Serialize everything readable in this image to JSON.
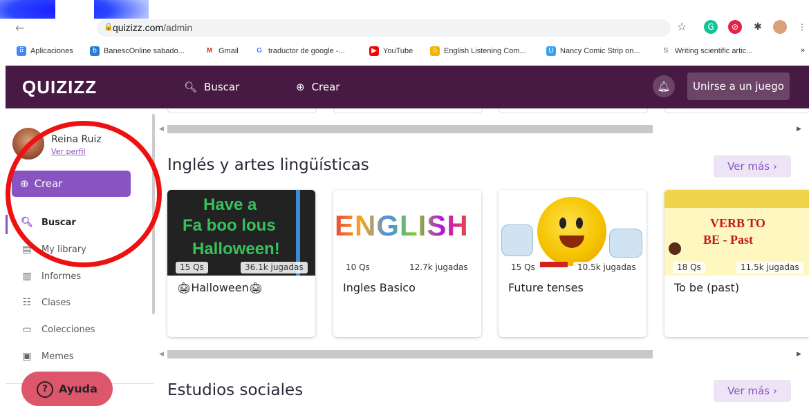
{
  "browser": {
    "url_host": "quizizz.com",
    "url_path": "/admin",
    "bookmarks": [
      "Aplicaciones",
      "BanescOnline sabado...",
      "Gmail",
      "traductor de google -...",
      "YouTube",
      "English Listening Com...",
      "Nancy Comic Strip on...",
      "Writing scientific artic..."
    ],
    "more": "»"
  },
  "header": {
    "logo": "QUIZIZZ",
    "search_label": "Buscar",
    "create_label": "Crear",
    "join_label": "Unirse a un juego"
  },
  "sidebar": {
    "user_name": "Reina Ruiz",
    "profile_link": "Ver perfil",
    "create_label": "Crear",
    "items": [
      {
        "label": "Buscar",
        "icon": "search-icon"
      },
      {
        "label": "My library",
        "icon": "library-icon"
      },
      {
        "label": "Informes",
        "icon": "chart-icon"
      },
      {
        "label": "Clases",
        "icon": "classes-icon"
      },
      {
        "label": "Colecciones",
        "icon": "folder-icon"
      },
      {
        "label": "Memes",
        "icon": "image-icon"
      }
    ],
    "help_label": "Ayuda"
  },
  "sections": [
    {
      "title": "Inglés y artes lingüísticas",
      "see_more": "Ver más",
      "cards": [
        {
          "title": "Halloween",
          "questions": "15 Qs",
          "plays": "36.1k jugadas",
          "thumb_text": [
            "Have a",
            "Fa boo lous",
            "Halloween!"
          ]
        },
        {
          "title": "Ingles Basico",
          "questions": "10 Qs",
          "plays": "12.7k jugadas",
          "thumb_text": [
            "ENGLISH"
          ]
        },
        {
          "title": "Future tenses",
          "questions": "15 Qs",
          "plays": "10.5k jugadas",
          "thumb_text": []
        },
        {
          "title": "To be (past)",
          "questions": "18 Qs",
          "plays": "11.5k jugadas",
          "thumb_text": [
            "VERB TO",
            "BE - Past"
          ]
        }
      ]
    },
    {
      "title": "Estudios sociales",
      "see_more": "Ver más"
    }
  ],
  "colors": {
    "header_bg": "#461a42",
    "primary": "#8854c0",
    "help_bg": "#de566c",
    "annotation_red": "#ee1111"
  }
}
